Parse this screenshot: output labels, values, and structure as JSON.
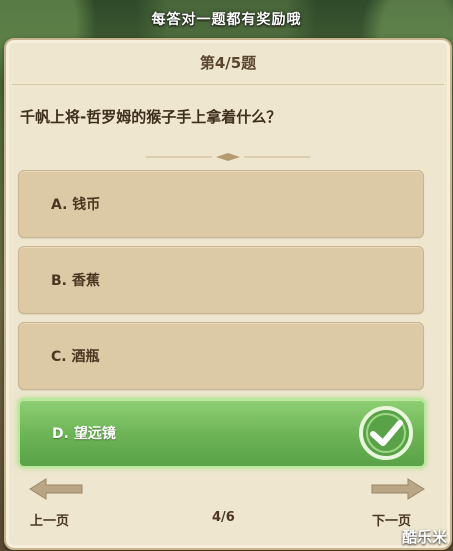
{
  "banner": {
    "text": "每答对一题都有奖励哦"
  },
  "quiz": {
    "header": "第4/5题",
    "question": "千帆上将-哲罗姆的猴子手上拿着什么？",
    "options": [
      {
        "label": "A. 钱币",
        "selected": false
      },
      {
        "label": "B. 香蕉",
        "selected": false
      },
      {
        "label": "C. 酒瓶",
        "selected": false
      },
      {
        "label": "D. 望远镜",
        "selected": true
      }
    ],
    "correct_icon": "checkmark-icon"
  },
  "nav": {
    "prev_label": "上一页",
    "next_label": "下一页",
    "page_counter": "4/6"
  },
  "watermark": {
    "text": "酷乐米"
  },
  "colors": {
    "card_bg": "#eee6cf",
    "option_bg": "#dcc9a6",
    "correct_green": "#6bb355",
    "text_brown": "#4a3721"
  }
}
